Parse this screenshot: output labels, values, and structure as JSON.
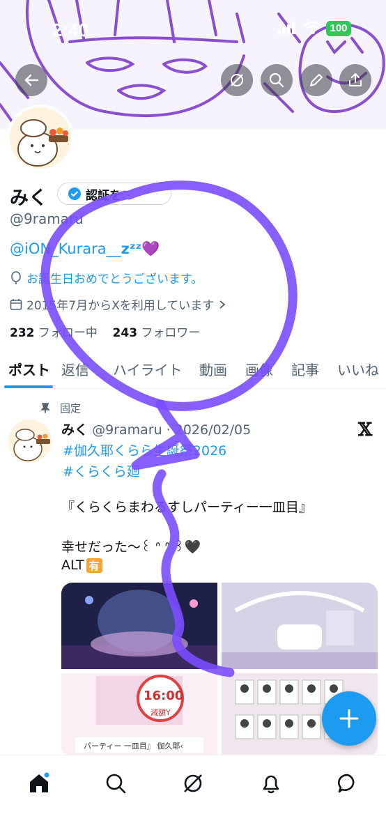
{
  "status": {
    "time": "2:40",
    "battery": "100"
  },
  "profile": {
    "name": "みく",
    "verify_label": "認証を",
    "handle": "@9ramaru",
    "bio_mention": "@iON_Kurara__",
    "bio_zzz": "zᶻᶻ",
    "bio_heart": "💜",
    "birthday": "お誕生日おめでとうございます。",
    "joined": "2015年7月からXを利用しています",
    "following_count": "232",
    "following_label": "フォロー中",
    "followers_count": "243",
    "followers_label": "フォロワー"
  },
  "tabs": [
    "ポスト",
    "返信",
    "ハイライト",
    "動画",
    "画像",
    "記事",
    "いいね"
  ],
  "tweet": {
    "pinned_label": "固定",
    "name": "みく",
    "handle_date": "@9ramaru · 2026/02/05",
    "hashtag1": "#伽久耶くらら生誕祭2026",
    "hashtag2": "#くらくら廻",
    "line1": "『くらくらまわるすしパーティー一皿目』",
    "line2": "幸せだった〜꒰ ᐢ ᐢ ꒱🖤",
    "alt_text": "ALT",
    "alt_badge": "有",
    "thumb_time": "16:00",
    "thumb_stamp": "減額Y",
    "thumb_caption": "パーティー 一皿目』 伽久耶‹"
  },
  "colors": {
    "accent": "#1d9bf0",
    "marker": "#7a4dff",
    "text": "#0f1419",
    "muted": "#536471"
  },
  "icons": [
    "back-arrow-icon",
    "grok-icon",
    "search-icon",
    "pencil-icon",
    "share-icon",
    "verified-badge-icon",
    "balloon-icon",
    "calendar-icon",
    "chevron-right-icon",
    "pin-icon",
    "x-logo-icon",
    "plus-icon",
    "home-icon",
    "explore-icon",
    "grok-nav-icon",
    "bell-icon",
    "message-icon"
  ]
}
